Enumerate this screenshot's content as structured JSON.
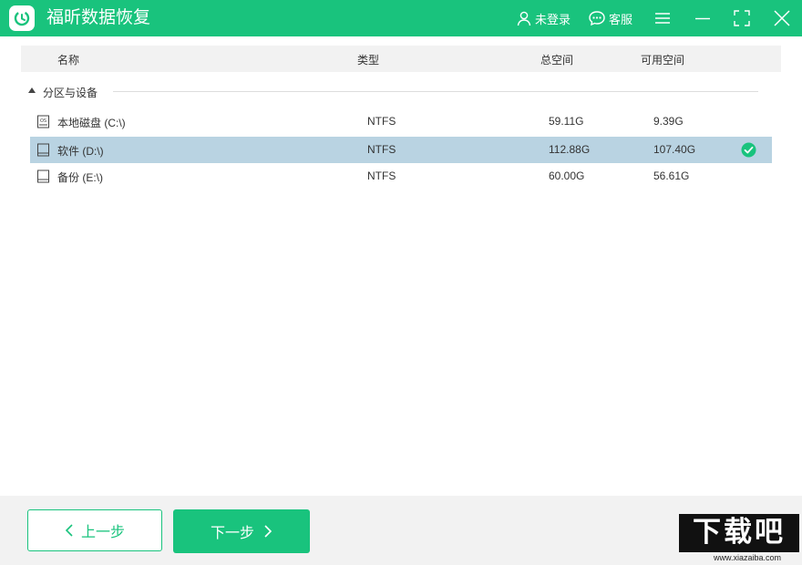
{
  "app": {
    "title": "福昕数据恢复"
  },
  "titlebar": {
    "user_label": "未登录",
    "service_label": "客服",
    "icons": [
      "user-icon",
      "chat-icon",
      "menu-icon",
      "minimize-icon",
      "fullscreen-icon",
      "close-icon"
    ]
  },
  "columns": {
    "name": "名称",
    "type": "类型",
    "total": "总空间",
    "free": "可用空间"
  },
  "group": {
    "label": "分区与设备"
  },
  "drives": [
    {
      "name": "本地磁盘 (C:\\)",
      "type": "NTFS",
      "total": "59.11G",
      "free": "9.39G",
      "icon": "os-drive-icon",
      "selected": false
    },
    {
      "name": "软件 (D:\\)",
      "type": "NTFS",
      "total": "112.88G",
      "free": "107.40G",
      "icon": "drive-icon",
      "selected": true
    },
    {
      "name": "备份 (E:\\)",
      "type": "NTFS",
      "total": "60.00G",
      "free": "56.61G",
      "icon": "drive-icon",
      "selected": false
    }
  ],
  "footer": {
    "prev_label": "上一步",
    "next_label": "下一步"
  },
  "watermark": {
    "logo_text": "下载吧",
    "url": "www.xiazaiba.com"
  },
  "colors": {
    "brand": "#19c37d",
    "selected_row": "#b9d3e2",
    "footer_bg": "#f2f2f2"
  }
}
